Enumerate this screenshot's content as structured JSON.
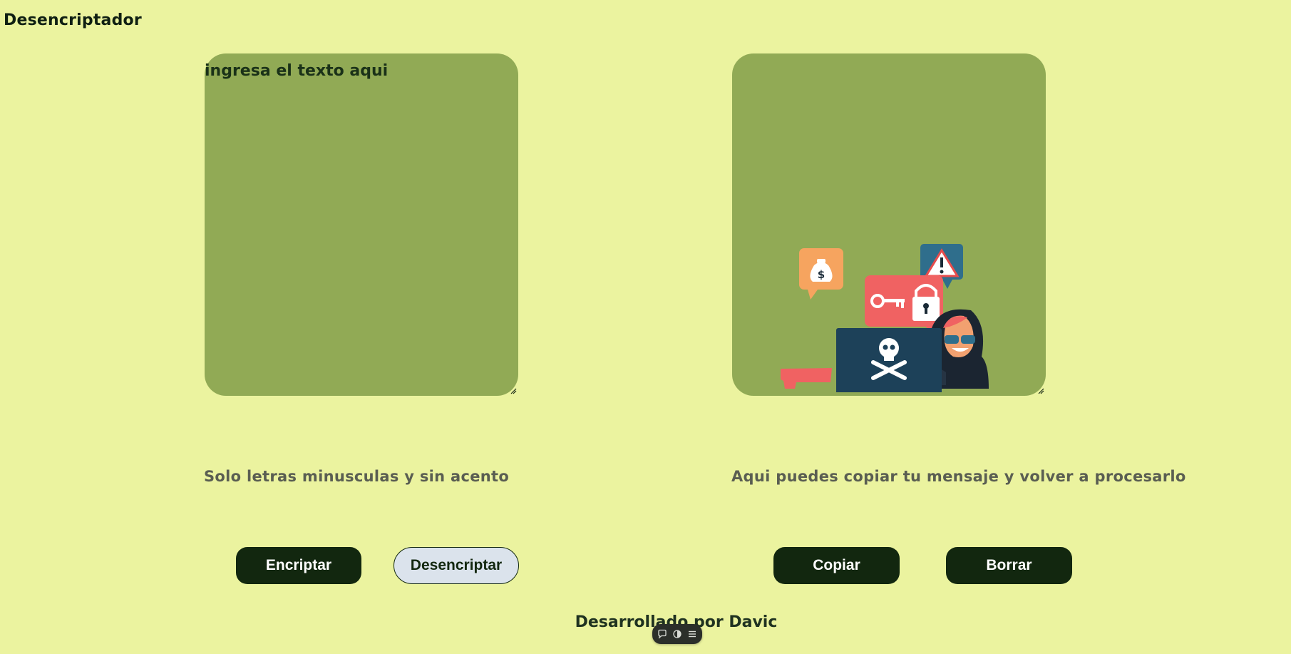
{
  "app": {
    "title": "Desencriptador"
  },
  "input": {
    "value": "ingresa el texto aqui"
  },
  "hints": {
    "left": "Solo letras minusculas y sin acento",
    "right": "Aqui puedes copiar tu mensaje y volver a procesarlo"
  },
  "buttons": {
    "encrypt": "Encriptar",
    "decrypt": "Desencriptar",
    "copy": "Copiar",
    "clear": "Borrar"
  },
  "footer": {
    "text": "Desarrollado por Davic"
  },
  "colors": {
    "background": "#ebf39f",
    "panel": "#91aa55",
    "button_dark": "#12270f",
    "button_light": "#dbe3ec"
  },
  "icons": [
    "chat-icon",
    "contrast-icon",
    "menu-icon"
  ]
}
